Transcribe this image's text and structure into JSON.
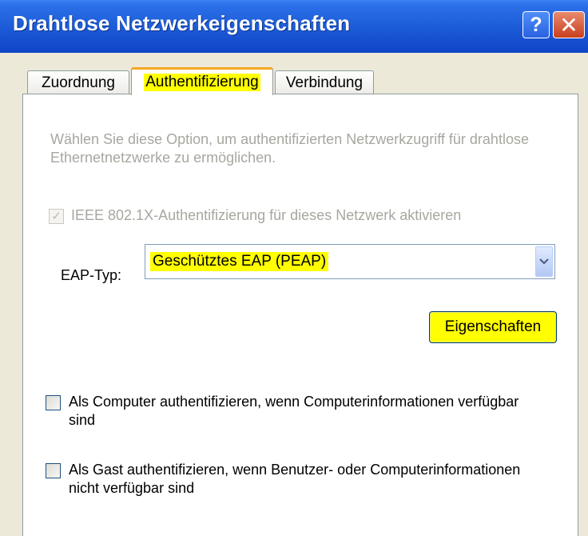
{
  "window": {
    "title": "Drahtlose Netzwerkeigenschaften",
    "help_label": "?",
    "close_label": "✕"
  },
  "tabs": [
    {
      "label": "Zuordnung",
      "selected": false
    },
    {
      "label": "Authentifizierung",
      "selected": true
    },
    {
      "label": "Verbindung",
      "selected": false
    }
  ],
  "auth": {
    "description": "Wählen Sie diese Option, um authentifizierten Netzwerkzugriff für drahtlose Ethernetnetzwerke zu ermöglichen.",
    "ieee_label": "IEEE 802.1X-Authentifizierung für dieses Netzwerk aktivieren",
    "ieee_checked": true,
    "ieee_enabled": false,
    "eap_label": "EAP-Typ:",
    "eap_value": "Geschütztes EAP (PEAP)",
    "properties_button": "Eigenschaften",
    "computer_auth_label": "Als Computer authentifizieren, wenn Computerinformationen verfügbar sind",
    "computer_auth_checked": false,
    "guest_auth_label": "Als Gast authentifizieren, wenn Benutzer- oder Computerinformationen nicht verfügbar sind",
    "guest_auth_checked": false
  },
  "colors": {
    "titlebar": "#1F5FDA",
    "highlight": "#FFFF00",
    "disabled_text": "#A7A7A0",
    "dialog_bg": "#ECE9D8"
  },
  "icons": {
    "checkmark": "✓",
    "dropdown": "chevron-down-icon"
  }
}
